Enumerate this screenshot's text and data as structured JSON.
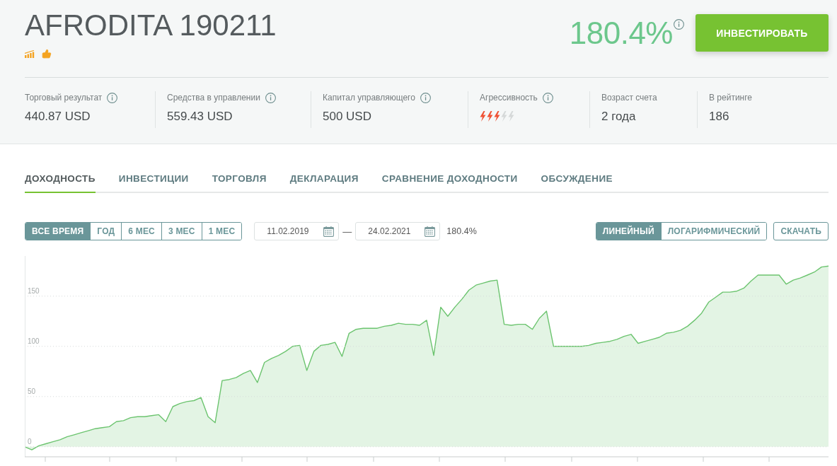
{
  "header": {
    "title": "AFRODITA 190211",
    "return": "180.4%",
    "invest_button": "ИНВЕСТИРОВАТЬ"
  },
  "stats": [
    {
      "kind": "text",
      "label": "Торговый результат",
      "info": true,
      "value": "440.87 USD"
    },
    {
      "kind": "text",
      "label": "Средства в управлении",
      "info": true,
      "value": "559.43 USD"
    },
    {
      "kind": "text",
      "label": "Капитал управляющего",
      "info": true,
      "value": "500 USD"
    },
    {
      "kind": "rating",
      "label": "Агрессивность",
      "info": true,
      "stars": 3
    },
    {
      "kind": "text",
      "label": "Возраст счета",
      "info": false,
      "value": "2 года"
    },
    {
      "kind": "text",
      "label": "В рейтинге",
      "info": false,
      "value": "186"
    }
  ],
  "tabs": [
    {
      "label": "ДОХОДНОСТЬ",
      "selected": true
    },
    {
      "label": "ИНВЕСТИЦИИ",
      "selected": false
    },
    {
      "label": "ТОРГОВЛЯ",
      "selected": false
    },
    {
      "label": "ДЕКЛАРАЦИЯ",
      "selected": false
    },
    {
      "label": "СРАВНЕНИЕ ДОХОДНОСТИ",
      "selected": false
    },
    {
      "label": "ОБСУЖДЕНИЕ",
      "selected": false
    }
  ],
  "periods": [
    {
      "label": "ВСЕ ВРЕМЯ",
      "selected": true
    },
    {
      "label": "ГОД",
      "selected": false
    },
    {
      "label": "6 МЕС",
      "selected": false
    },
    {
      "label": "3 МЕС",
      "selected": false
    },
    {
      "label": "1 МЕС",
      "selected": false
    }
  ],
  "date_range": {
    "from": "11.02.2019",
    "separator": "—",
    "to": "24.02.2021",
    "result": "180.4%"
  },
  "scale_modes": [
    {
      "label": "ЛИНЕЙНЫЙ",
      "selected": true
    },
    {
      "label": "ЛОГАРИФМИЧЕСКИЙ",
      "selected": false
    }
  ],
  "download_button": "СКАЧАТЬ",
  "chart_data": {
    "type": "area",
    "color": "#6cc46f",
    "yticks": [
      0,
      50,
      100,
      150
    ],
    "ylim": [
      -10,
      190
    ],
    "tick_labels": "y",
    "grid": true,
    "values": [
      0,
      -3,
      1,
      3,
      5,
      7,
      10,
      12,
      14,
      16,
      18,
      19,
      20,
      25,
      26,
      29,
      30,
      30,
      31,
      32,
      25,
      40,
      43,
      45,
      46,
      49,
      30,
      24,
      66,
      67,
      69,
      73,
      76,
      64,
      84,
      88,
      91,
      95,
      100,
      101,
      76,
      95,
      101,
      102,
      104,
      90,
      113,
      117,
      118,
      118,
      118,
      120,
      121,
      123,
      122,
      122,
      121,
      126,
      91,
      139,
      130,
      139,
      147,
      156,
      161,
      163,
      165,
      166,
      122,
      121,
      122,
      122,
      117,
      128,
      135,
      100,
      100,
      100,
      100,
      100,
      101,
      103,
      104,
      105,
      107,
      110,
      112,
      103,
      105,
      107,
      109,
      113,
      114,
      116,
      120,
      126,
      133,
      144,
      149,
      154,
      154,
      155,
      158,
      165,
      171,
      171,
      171,
      171,
      162,
      166,
      168,
      171,
      174,
      179,
      180
    ]
  }
}
